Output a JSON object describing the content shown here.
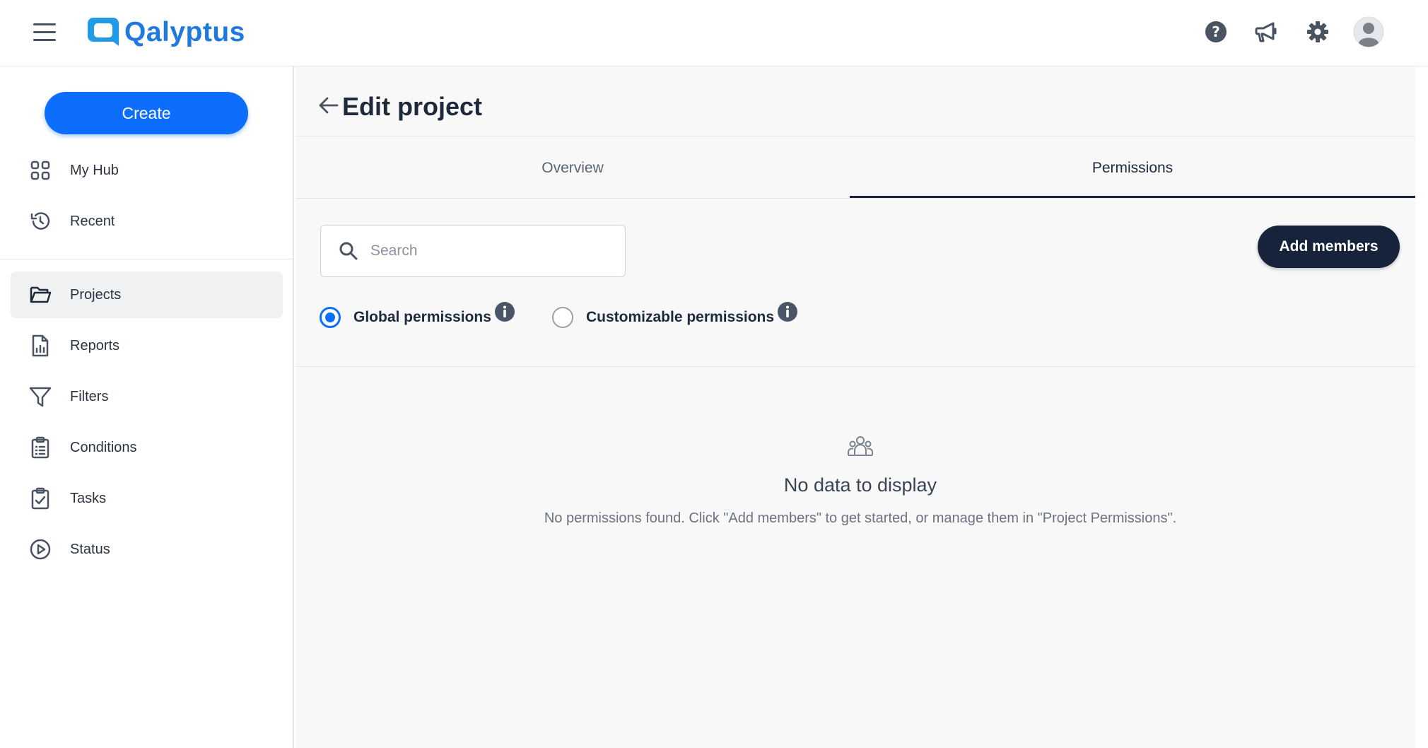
{
  "app": {
    "name": "Qalyptus"
  },
  "topbar": {
    "menu_icon": "hamburger-menu-icon",
    "icons": [
      "help-icon",
      "announcement-icon",
      "settings-gear-icon",
      "user-avatar-icon"
    ]
  },
  "sidebar": {
    "create_label": "Create",
    "items": [
      {
        "label": "My Hub",
        "icon": "grid-icon"
      },
      {
        "label": "Recent",
        "icon": "history-icon"
      },
      {
        "label": "Projects",
        "icon": "folder-icon",
        "active": true
      },
      {
        "label": "Reports",
        "icon": "report-icon"
      },
      {
        "label": "Filters",
        "icon": "filter-icon"
      },
      {
        "label": "Conditions",
        "icon": "clipboard-list-icon"
      },
      {
        "label": "Tasks",
        "icon": "clipboard-check-icon"
      },
      {
        "label": "Status",
        "icon": "play-circle-icon"
      }
    ]
  },
  "page": {
    "title": "Edit project",
    "tabs": [
      {
        "label": "Overview",
        "active": false
      },
      {
        "label": "Permissions",
        "active": true
      }
    ]
  },
  "permissions": {
    "search_placeholder": "Search",
    "add_members_label": "Add members",
    "options": [
      {
        "label": "Global permissions",
        "checked": true
      },
      {
        "label": "Customizable permissions",
        "checked": false
      }
    ],
    "empty_title": "No data to display",
    "empty_text": "No permissions found. Click \"Add members\" to get started, or manage them in \"Project Permissions\"."
  },
  "colors": {
    "brand": "#1f7ae0",
    "primary_button": "#0d6efd",
    "dark_button": "#16233b",
    "tab_underline": "#1b2438"
  }
}
